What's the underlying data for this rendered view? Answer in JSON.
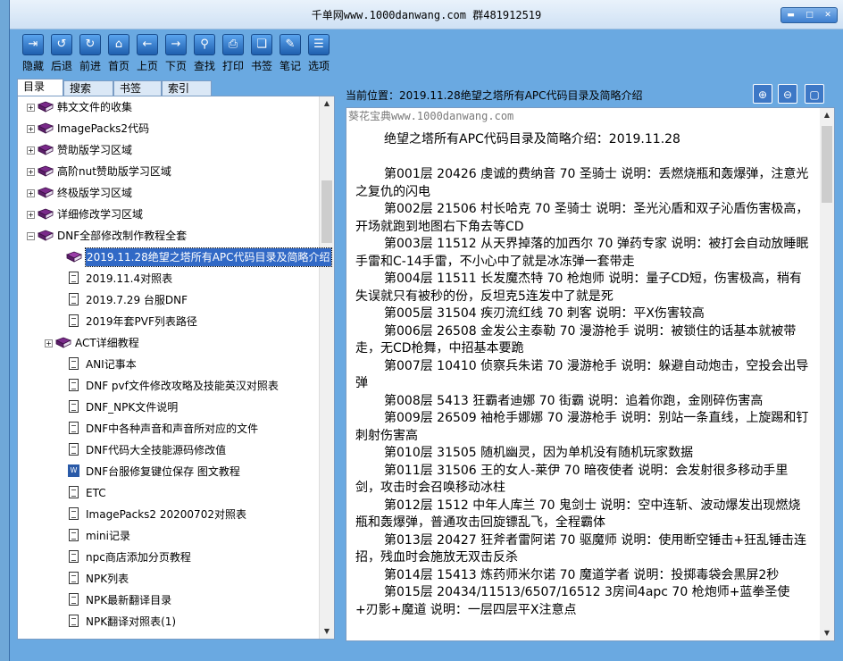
{
  "window": {
    "title": "千单网www.1000danwang.com 群481912519",
    "controls": [
      "▬",
      "□",
      "✕"
    ]
  },
  "toolbar": [
    {
      "label": "隐藏",
      "icon": "hide-icon",
      "glyph": "⇥"
    },
    {
      "label": "后退",
      "icon": "back-icon",
      "glyph": "↺"
    },
    {
      "label": "前进",
      "icon": "forward-icon",
      "glyph": "↻"
    },
    {
      "label": "首页",
      "icon": "home-icon",
      "glyph": "⌂"
    },
    {
      "label": "上页",
      "icon": "prev-page-icon",
      "glyph": "←"
    },
    {
      "label": "下页",
      "icon": "next-page-icon",
      "glyph": "→"
    },
    {
      "label": "查找",
      "icon": "search-icon",
      "glyph": "⚲"
    },
    {
      "label": "打印",
      "icon": "print-icon",
      "glyph": "⎙"
    },
    {
      "label": "书签",
      "icon": "bookmark-icon",
      "glyph": "❏"
    },
    {
      "label": "笔记",
      "icon": "notes-icon",
      "glyph": "✎"
    },
    {
      "label": "选项",
      "icon": "options-icon",
      "glyph": "☰"
    }
  ],
  "tabs": [
    "目录",
    "搜索",
    "书签",
    "索引"
  ],
  "tree": [
    {
      "label": "韩文文件的收集",
      "kind": "book",
      "level": 0,
      "expander": "+"
    },
    {
      "label": "ImagePacks2代码",
      "kind": "book",
      "level": 0,
      "expander": "+"
    },
    {
      "label": "赞助版学习区域",
      "kind": "book",
      "level": 0,
      "expander": "+"
    },
    {
      "label": "高阶nut赞助版学习区域",
      "kind": "book",
      "level": 0,
      "expander": "+"
    },
    {
      "label": "终极版学习区域",
      "kind": "book",
      "level": 0,
      "expander": "+"
    },
    {
      "label": "详细修改学习区域",
      "kind": "book",
      "level": 0,
      "expander": "+"
    },
    {
      "label": "DNF全部修改制作教程全套",
      "kind": "book",
      "level": 0,
      "expander": "−"
    },
    {
      "label": "2019.11.28绝望之塔所有APC代码目录及简略介绍",
      "kind": "openbook",
      "level": 1,
      "selected": true
    },
    {
      "label": "2019.11.4对照表",
      "kind": "page",
      "level": 1
    },
    {
      "label": "2019.7.29  台服DNF",
      "kind": "page",
      "level": 1
    },
    {
      "label": "2019年套PVF列表路径",
      "kind": "page",
      "level": 1
    },
    {
      "label": "ACT详细教程",
      "kind": "book",
      "level": 1,
      "expander": "+"
    },
    {
      "label": "ANI记事本",
      "kind": "page",
      "level": 1
    },
    {
      "label": "DNF pvf文件修改攻略及技能英汉对照表",
      "kind": "page",
      "level": 1
    },
    {
      "label": "DNF_NPK文件说明",
      "kind": "page",
      "level": 1
    },
    {
      "label": "DNF中各种声音和声音所对应的文件",
      "kind": "page",
      "level": 1
    },
    {
      "label": "DNF代码大全技能源码修改值",
      "kind": "page",
      "level": 1
    },
    {
      "label": "DNF台服修复键位保存 图文教程",
      "kind": "word",
      "level": 1
    },
    {
      "label": "ETC",
      "kind": "page",
      "level": 1
    },
    {
      "label": "ImagePacks2 20200702对照表",
      "kind": "page",
      "level": 1
    },
    {
      "label": "mini记录",
      "kind": "page",
      "level": 1
    },
    {
      "label": "npc商店添加分页教程",
      "kind": "page",
      "level": 1
    },
    {
      "label": "NPK列表",
      "kind": "page",
      "level": 1
    },
    {
      "label": "NPK最新翻译目录",
      "kind": "page",
      "level": 1
    },
    {
      "label": "NPK翻译对照表(1)",
      "kind": "page",
      "level": 1
    }
  ],
  "location": {
    "prefix": "当前位置：",
    "value": "2019.11.28绝望之塔所有APC代码目录及简略介绍"
  },
  "right_buttons": [
    {
      "icon": "zoom-in-icon",
      "glyph": "⊕"
    },
    {
      "icon": "zoom-out-icon",
      "glyph": "⊖"
    },
    {
      "icon": "fullscreen-icon",
      "glyph": "▢"
    }
  ],
  "content": {
    "watermark": "葵花宝典www.1000danwang.com",
    "heading": "绝望之塔所有APC代码目录及简略介绍：2019.11.28",
    "paragraphs": [
      "第001层  20426  虔诚的费纳音 70 圣骑士  说明：丢燃烧瓶和轰爆弹，注意光之复仇的闪电",
      "第002层  21506  村长哈克  70  圣骑士  说明：圣光沁盾和双子沁盾伤害极高，开场就跑到地图右下角去等CD",
      "第003层  11512  从天界掉落的加西尔  70  弹药专家  说明：被打会自动放睡眠手雷和C-14手雷，不小心中了就是冰冻弹一套带走",
      "第004层  11511  长发魔杰特  70  枪炮师  说明：量子CD短，伤害极高，稍有失误就只有被秒的份，反坦克5连发中了就是死",
      "第005层  31504  疾刃流红线  70  刺客  说明：平X伤害较高",
      "第006层  26508  金发公主泰勒  70  漫游枪手  说明：被锁住的话基本就被带走，无CD枪舞，中招基本要跪",
      "第007层  10410  侦察兵朱诺  70  漫游枪手  说明：躲避自动炮击，空投会出导弹",
      "第008层  5413  狂霸者迪娜  70  街霸  说明：追着你跑，金刚碎伤害高",
      "第009层  26509  袖枪手娜娜  70  漫游枪手  说明：别站一条直线，上旋踢和钉刺射伤害高",
      "第010层  31505  随机幽灵，因为单机没有随机玩家数据",
      "第011层  31506  王的女人-莱伊  70  暗夜使者  说明：会发射很多移动手里剑，攻击时会召唤移动冰柱",
      "第012层  1512  中年人库兰  70  鬼剑士  说明：空中连斩、波动爆发出现燃烧瓶和轰爆弹，普通攻击回旋镖乱飞，全程霸体",
      "第013层  20427  狂斧者雷阿诺  70  驱魔师  说明：使用断空锤击+狂乱锤击连招，残血时会施放无双击反杀",
      "第014层  15413  炼药师米尔诺  70  魔道学者  说明：投掷毒袋会黑屏2秒",
      "第015层  20434/11513/6507/16512 3房间4apc  70  枪炮师+蓝拳圣使+刃影+魔道  说明：一层四层平X注意点"
    ]
  }
}
